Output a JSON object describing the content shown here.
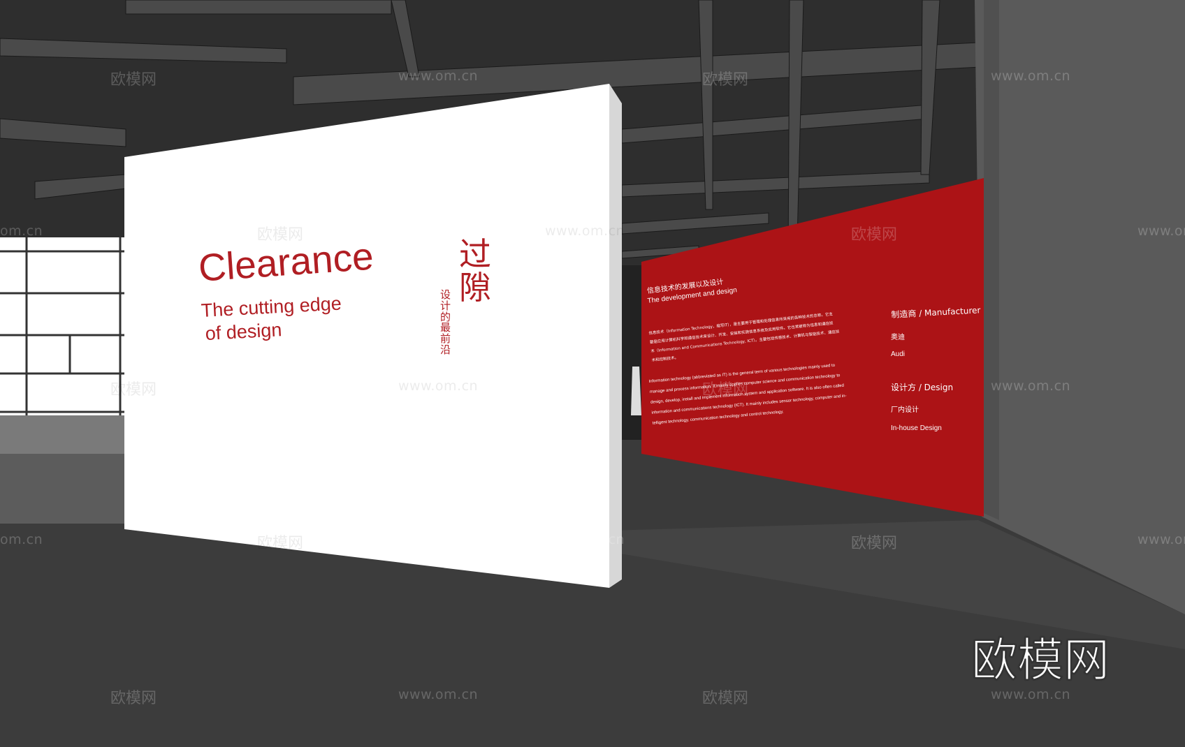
{
  "white_wall": {
    "title": "Clearance",
    "subtitle_line1": "The cutting edge",
    "subtitle_line2": "of design",
    "chinese_title": [
      "过",
      "隙"
    ],
    "chinese_subtitle": [
      "设",
      "计",
      "的",
      "最",
      "前",
      "沿"
    ]
  },
  "red_wall": {
    "heading_cn": "信息技术的发展以及设计",
    "heading_en": "The development and design",
    "body_cn": [
      "信息技术（Information Technology，缩写IT），是主要用于管理和处理信息所采用的各种技术的总称。它主",
      "要是应用计算机科学和通信技术来设计、开发、安装和实施信息系统及应用软件。它也常被称为信息和通信技",
      "术（Information and Communications Technology, ICT）。主要包括传感技术、计算机与智能技术、通信技",
      "术和控制技术。"
    ],
    "body_en": [
      "Information technology (abbreviated as IT) is the general term of various technologies mainly used to",
      "manage and process information. It mainly applies computer science and communication technology to",
      "design, develop, install and implement information system and application software. It is also often called",
      "information and communications technology (ICT). It mainly includes sensor technology, computer and in-",
      "telligent technology, communication technology and control technology."
    ],
    "manufacturer_label": "制造商 / Manufacturer",
    "manufacturer_cn": "奥迪",
    "manufacturer_en": "Audi",
    "design_label": "设计方 / Design",
    "design_cn": "厂内设计",
    "design_en": "In-house Design"
  },
  "watermark": {
    "logo_text": "欧模网",
    "url_text": "www.om.cn",
    "url_partial": "om.cn",
    "corner_logo": "欧模网"
  },
  "colors": {
    "brand_red": "#b01e23",
    "wall_red": "#ac1316",
    "wall_white": "#ffffff",
    "ceiling_dark": "#2b2b2b",
    "floor": "#3b3b3b"
  }
}
